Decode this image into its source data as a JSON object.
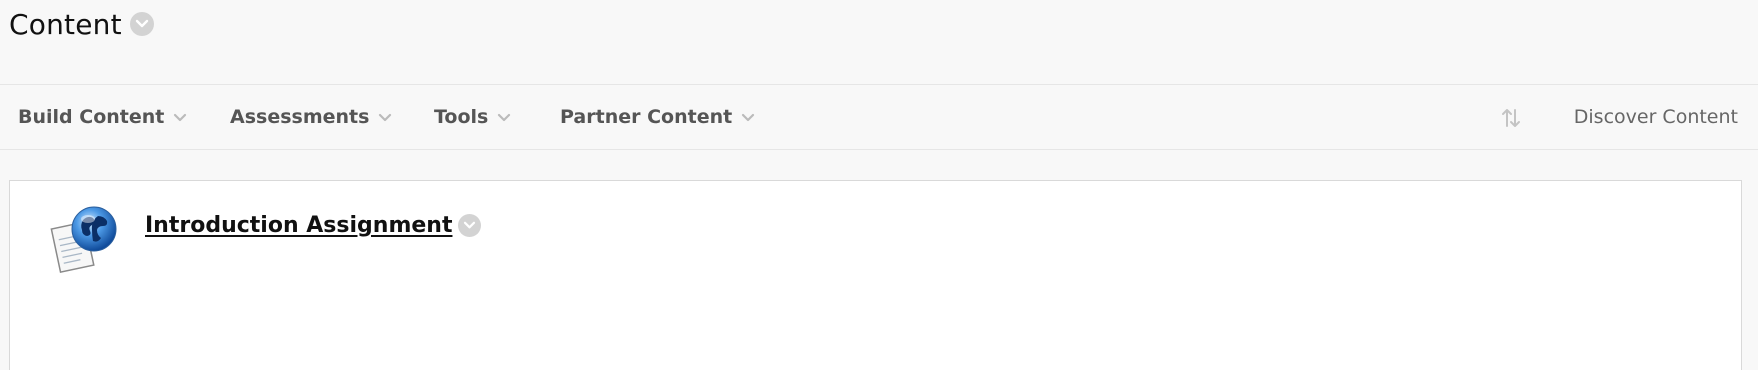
{
  "header": {
    "title": "Content"
  },
  "action_bar": {
    "menus": [
      {
        "label": "Build Content"
      },
      {
        "label": "Assessments"
      },
      {
        "label": "Tools"
      },
      {
        "label": "Partner Content"
      }
    ],
    "discover_label": "Discover Content"
  },
  "content": {
    "items": [
      {
        "title": "Introduction Assignment",
        "icon": "globe-document-icon"
      }
    ]
  },
  "colors": {
    "background": "#f8f8f8",
    "panel": "#ffffff",
    "menu_circle": "#d3d3d3",
    "bar_text": "#555555",
    "title_text": "#111111"
  }
}
